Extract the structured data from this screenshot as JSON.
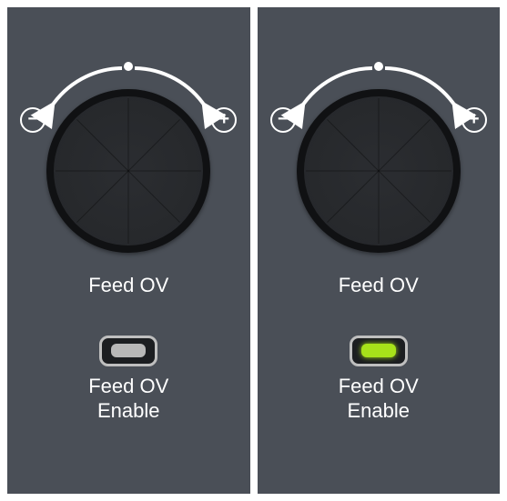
{
  "panels": [
    {
      "knob_label": "Feed OV",
      "minus": "−",
      "plus": "+",
      "toggle_label_line1": "Feed OV",
      "toggle_label_line2": "Enable",
      "toggle_state": "off"
    },
    {
      "knob_label": "Feed OV",
      "minus": "−",
      "plus": "+",
      "toggle_label_line1": "Feed OV",
      "toggle_label_line2": "Enable",
      "toggle_state": "on"
    }
  ]
}
